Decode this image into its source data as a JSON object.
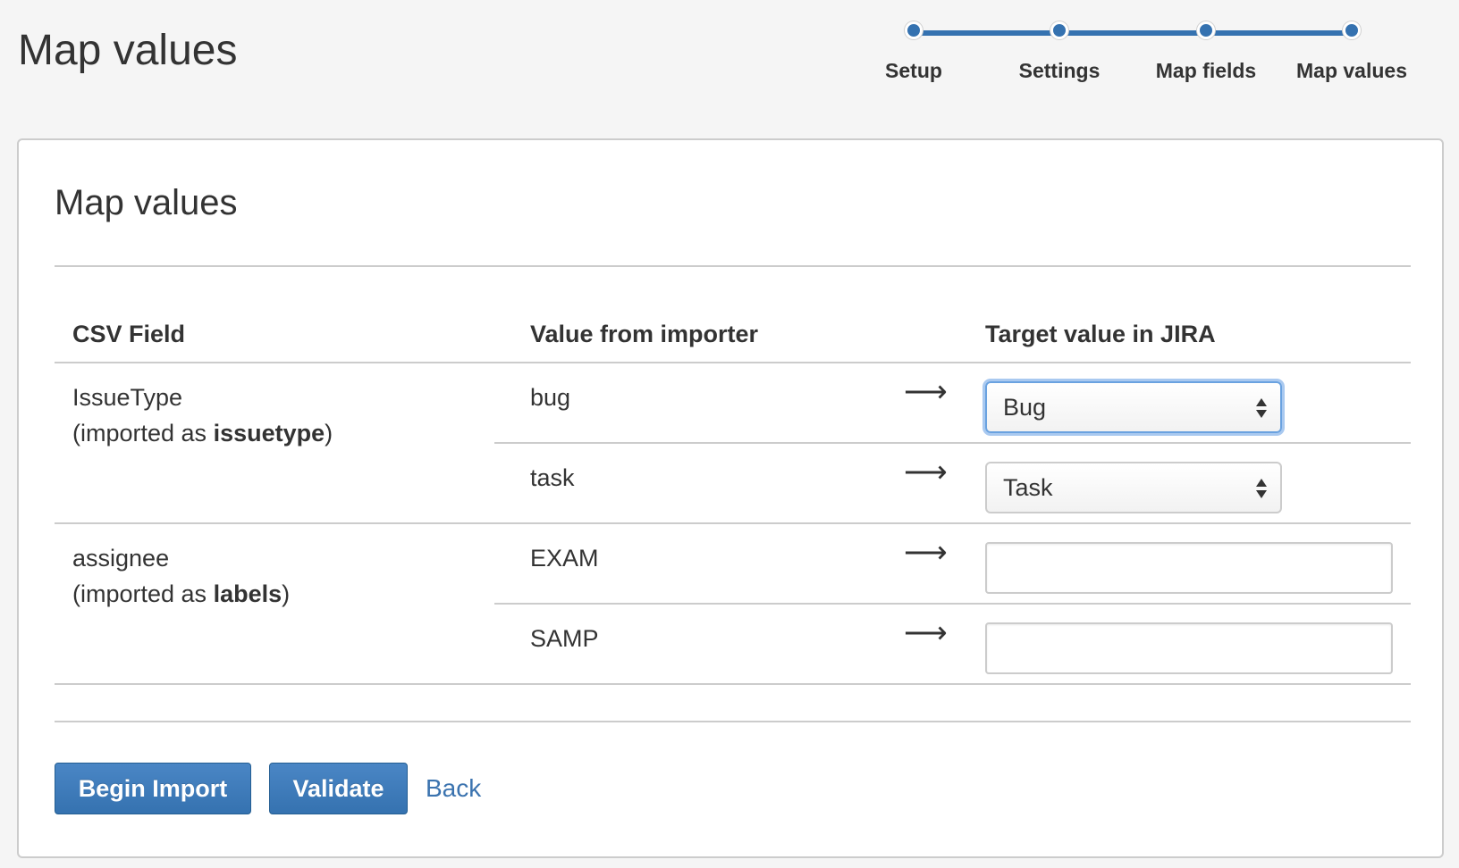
{
  "header": {
    "title": "Map values"
  },
  "tracker": {
    "steps": [
      {
        "label": "Setup"
      },
      {
        "label": "Settings"
      },
      {
        "label": "Map fields"
      },
      {
        "label": "Map values"
      }
    ],
    "current_step": 4,
    "color": "#3572b0"
  },
  "panel": {
    "title": "Map values",
    "columns": {
      "csv_field": "CSV Field",
      "value_from_importer": "Value from importer",
      "target_value": "Target value in JIRA"
    },
    "arrow_glyph": "⟶",
    "groups": [
      {
        "field_name": "IssueType",
        "imported_prefix": "(imported as ",
        "imported_as": "issuetype",
        "imported_suffix": ")",
        "rows": [
          {
            "value": "bug",
            "target_type": "select",
            "target_value": "Bug"
          },
          {
            "value": "task",
            "target_type": "select",
            "target_value": "Task"
          }
        ]
      },
      {
        "field_name": "assignee",
        "imported_prefix": "(imported as ",
        "imported_as": "labels",
        "imported_suffix": ")",
        "rows": [
          {
            "value": "EXAM",
            "target_type": "text",
            "target_value": ""
          },
          {
            "value": "SAMP",
            "target_type": "text",
            "target_value": ""
          }
        ]
      }
    ]
  },
  "actions": {
    "begin_import": "Begin Import",
    "validate": "Validate",
    "back": "Back"
  },
  "colors": {
    "primary_button": "#3572b0",
    "link": "#3b73af",
    "focus_ring": "#a9c9f0"
  }
}
